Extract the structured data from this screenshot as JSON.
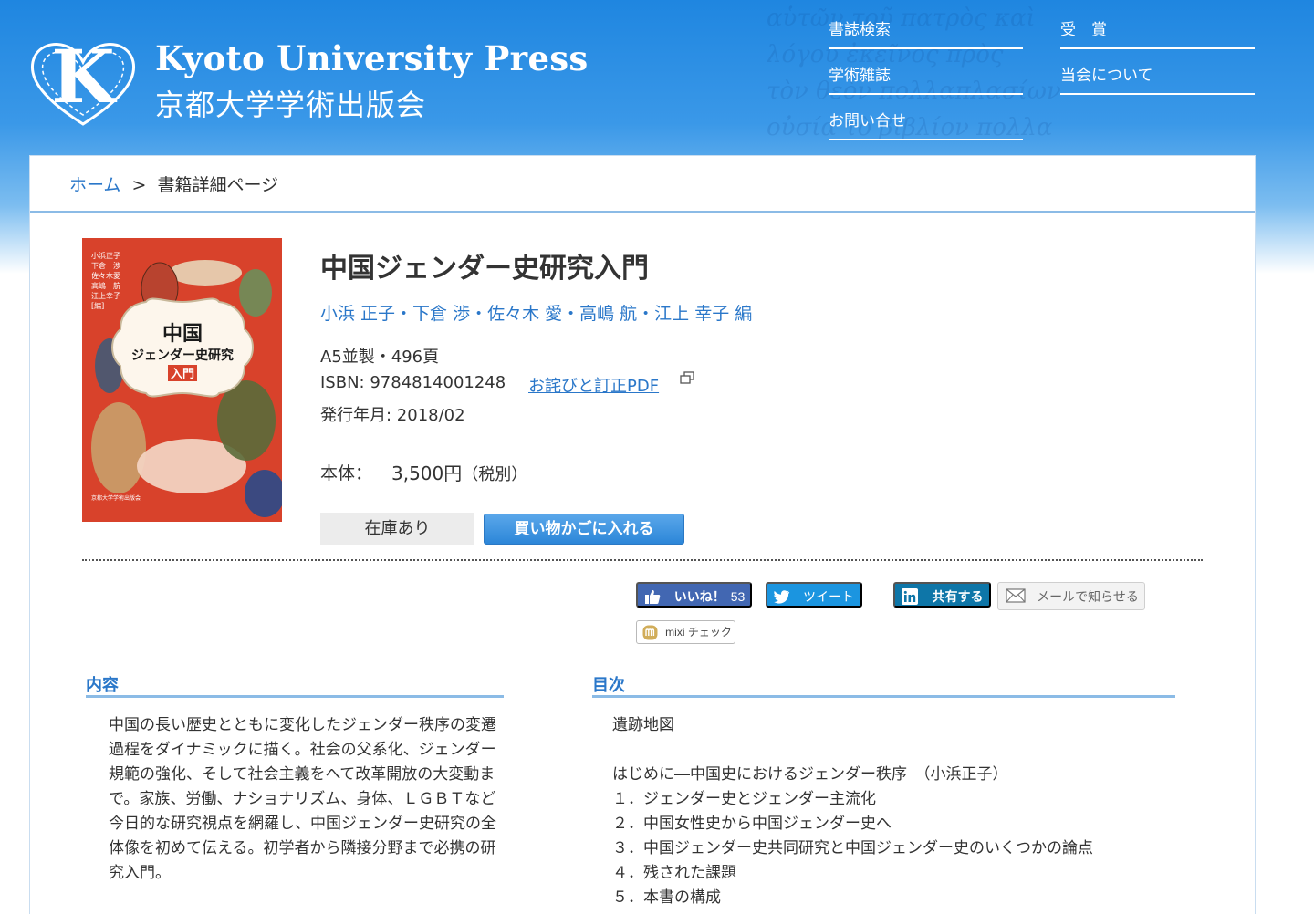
{
  "header": {
    "logo_letter": "K",
    "logo_en": "Kyoto University Press",
    "logo_ja": "京都大学学術出版会",
    "nav": [
      {
        "label": "書誌検索"
      },
      {
        "label": "受　賞"
      },
      {
        "label": "学術雑誌"
      },
      {
        "label": "当会について"
      },
      {
        "label": "お問い合せ"
      }
    ]
  },
  "breadcrumb": {
    "home": "ホーム",
    "separator": ">",
    "current": "書籍詳細ページ"
  },
  "book": {
    "title": "中国ジェンダー史研究入門",
    "authors": "小浜 正子・下倉 渉・佐々木 愛・高嶋 航・江上 幸子 編",
    "format": "A5並製・496頁",
    "isbn": "ISBN: 9784814001248",
    "erratum_link": "お詫びと訂正PDF",
    "pub_date": "発行年月: 2018/02",
    "price_label": "本体：",
    "price_value": "3,500円",
    "price_tax": "（税別）",
    "stock_label": "在庫あり",
    "cart_label": "買い物かごに入れる",
    "cover": {
      "authors_lines": [
        "小浜正子",
        "下倉　渉",
        "佐々木愛",
        "高嶋　航",
        "江上幸子"
      ],
      "ed_mark": "[編]",
      "title_line1": "中国",
      "title_line2": "ジェンダー史研究",
      "title_line3": "入門",
      "publisher": "京都大学学術出版会",
      "bg_color": "#d8422b"
    }
  },
  "social": {
    "like_label": "いいね！",
    "like_count": "53",
    "tweet_label": "ツイート",
    "share_label": "共有する",
    "mail_label": "メールで知らせる",
    "mixi_label": "mixi チェック"
  },
  "description": {
    "heading": "内容",
    "text": "中国の長い歴史とともに変化したジェンダー秩序の変遷過程をダイナミックに描く。社会の父系化、ジェンダー規範の強化、そして社会主義をへて改革開放の大変動まで。家族、労働、ナショナリズム、身体、ＬＧＢＴなど今日的な研究視点を網羅し、中国ジェンダー史研究の全体像を初めて伝える。初学者から隣接分野まで必携の研究入門。"
  },
  "toc": {
    "heading": "目次",
    "lines": [
      "遺跡地図",
      "",
      "はじめに―中国史におけるジェンダー秩序　（小浜正子）",
      "１．ジェンダー史とジェンダー主流化",
      "２．中国女性史から中国ジェンダー史へ",
      "３．中国ジェンダー史共同研究と中国ジェンダー史のいくつかの論点",
      "４．残された課題",
      "５．本書の構成"
    ]
  },
  "colors": {
    "header_blue": "#1f86e0",
    "link_blue": "#2a77c9",
    "cart_blue": "#2c86d8",
    "facebook": "#4267b2",
    "twitter": "#1b95e0",
    "linkedin": "#0e76a8"
  }
}
